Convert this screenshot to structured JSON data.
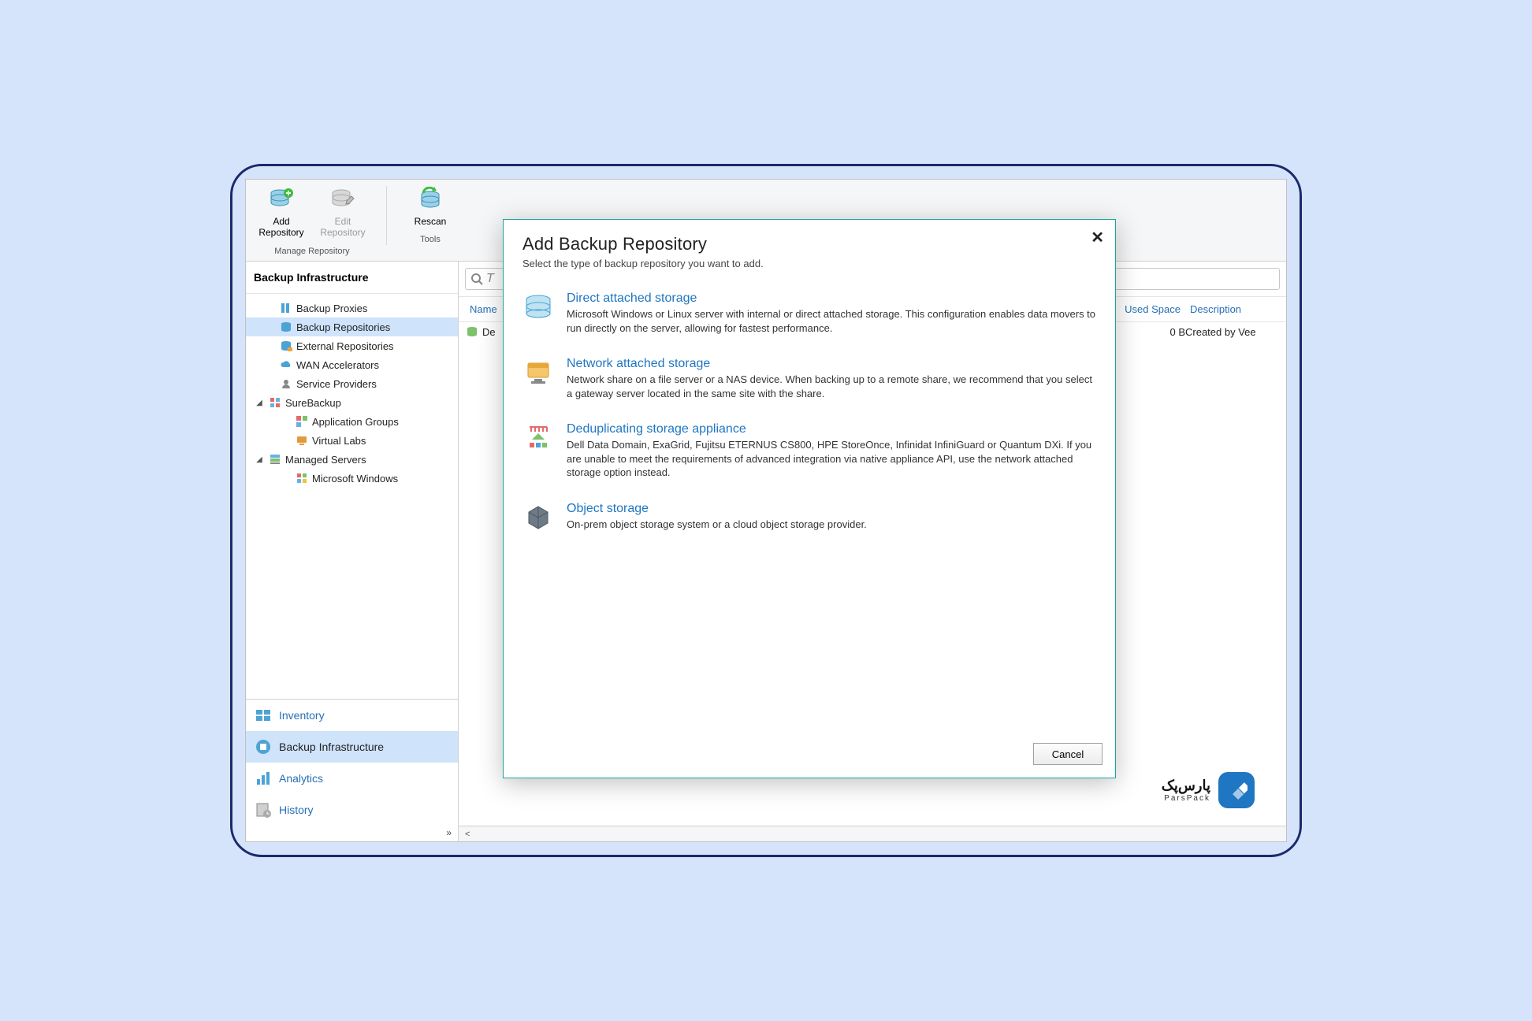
{
  "ribbon": {
    "add": {
      "label": "Add\nRepository"
    },
    "edit": {
      "label": "Edit\nRepository"
    },
    "rescan": {
      "label": "Rescan"
    },
    "group_manage": "Manage Repository",
    "group_tools": "Tools"
  },
  "sidebar": {
    "title": "Backup Infrastructure",
    "nodes": {
      "proxies": "Backup Proxies",
      "repos": "Backup Repositories",
      "extrepos": "External Repositories",
      "wan": "WAN Accelerators",
      "svcprov": "Service Providers",
      "surebackup": "SureBackup",
      "appgroups": "Application Groups",
      "vlabs": "Virtual Labs",
      "managed": "Managed Servers",
      "mswin": "Microsoft Windows"
    }
  },
  "bottom_nav": {
    "inventory": "Inventory",
    "backup_infra": "Backup Infrastructure",
    "analytics": "Analytics",
    "history": "History"
  },
  "main": {
    "search_placeholder": "T",
    "columns": {
      "name": "Name",
      "used": "Used Space",
      "desc": "Description"
    },
    "rows": [
      {
        "name": "De",
        "used": "0 B",
        "desc": "Created by Vee"
      }
    ]
  },
  "dialog": {
    "title": "Add Backup Repository",
    "subtitle": "Select the type of backup repository you want to add.",
    "options": [
      {
        "title": "Direct attached storage",
        "desc": "Microsoft Windows or Linux server with internal or direct attached storage. This configuration enables data movers to run directly on the server, allowing for fastest performance."
      },
      {
        "title": "Network attached storage",
        "desc": "Network share on a file server or a NAS device. When backing up to a remote share, we recommend that you select a gateway server located in the same site with the share."
      },
      {
        "title": "Deduplicating storage appliance",
        "desc": "Dell Data Domain, ExaGrid, Fujitsu ETERNUS CS800, HPE StoreOnce, Infinidat InfiniGuard or Quantum DXi. If you are unable to meet the requirements of advanced integration via native appliance API, use the network attached storage option instead."
      },
      {
        "title": "Object storage",
        "desc": "On-prem object storage system or a cloud object storage provider."
      }
    ],
    "cancel": "Cancel"
  },
  "brand": {
    "ar": "پارس‌پک",
    "en": "ParsPack"
  }
}
